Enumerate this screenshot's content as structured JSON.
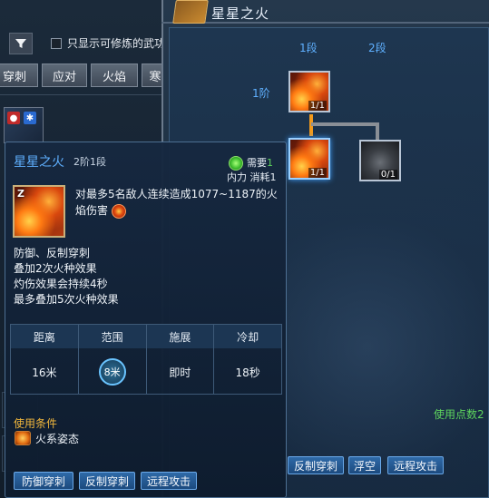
{
  "filter": {
    "label": "只显示可修炼的武功"
  },
  "category_tabs": [
    {
      "label": "穿刺"
    },
    {
      "label": "应对"
    },
    {
      "label": "火焰"
    },
    {
      "label": "寒"
    }
  ],
  "window": {
    "title": "星星之火"
  },
  "tree": {
    "columns": [
      "1段",
      "2段"
    ],
    "rows": [
      "1阶"
    ],
    "nodes": [
      {
        "level": "1/1",
        "state": "learned",
        "art": "fire"
      },
      {
        "level": "1/1",
        "state": "selected",
        "art": "fire"
      },
      {
        "level": "0/1",
        "state": "locked",
        "art": "smoke"
      }
    ],
    "use_points": "使用点数2",
    "tags": [
      "反制穿刺",
      "浮空",
      "远程攻击"
    ]
  },
  "tooltip": {
    "name": "星星之火",
    "rank": "2阶1段",
    "need_label": "需要",
    "need_value": "1",
    "cost": "内力 消耗1",
    "hotkey": "Z",
    "description": "对最多5名敌人连续造成1077~1187的火焰伤害",
    "effects": [
      "防御、反制穿刺",
      "叠加2次火种效果",
      "灼伤效果会持续4秒",
      "最多叠加5次火种效果"
    ],
    "stats": [
      {
        "head": "距离",
        "value": "16米"
      },
      {
        "head": "范围",
        "value": "8米"
      },
      {
        "head": "施展",
        "value": "即时"
      },
      {
        "head": "冷却",
        "value": "18秒"
      }
    ],
    "condition_label": "使用条件",
    "condition": "火系姿态",
    "tags": [
      "防御穿刺",
      "反制穿刺",
      "远程攻击"
    ]
  },
  "colors": {
    "accent_blue": "#5fb0ff",
    "green": "#5dd35d",
    "orange": "#f39a1c",
    "gold": "#f0b63c"
  }
}
